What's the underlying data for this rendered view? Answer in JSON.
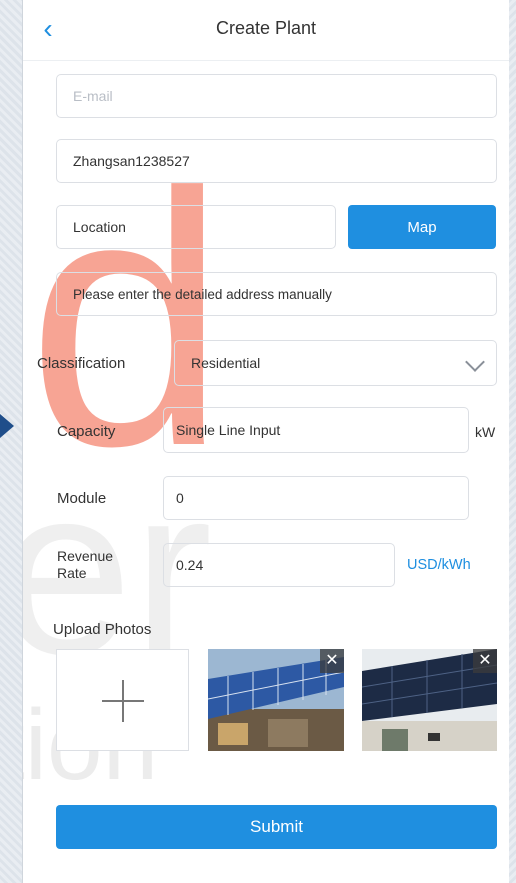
{
  "header": {
    "title": "Create Plant",
    "back_icon": "chevron-left-icon"
  },
  "form": {
    "email": {
      "placeholder": "E-mail",
      "value": ""
    },
    "username": {
      "value": "Zhangsan1238527"
    },
    "location": {
      "value": "Location",
      "map_label": "Map"
    },
    "address": {
      "placeholder": "Please enter the detailed address manually"
    },
    "classification": {
      "label": "Classification",
      "selected": "Residential"
    },
    "capacity": {
      "label": "Capacity",
      "placeholder": "Single Line Input",
      "unit": "kW"
    },
    "module": {
      "label": "Module",
      "placeholder": "0"
    },
    "revenue_rate": {
      "label": "Revenue Rate",
      "placeholder": "0.24",
      "unit": "USD/kWh"
    },
    "photos": {
      "label": "Upload Photos",
      "add_icon": "plus-icon",
      "remove_icon": "close-icon"
    },
    "submit_label": "Submit"
  },
  "colors": {
    "accent": "#1f8fe0",
    "border": "#dcdfe4",
    "placeholder": "#b9bec6"
  }
}
